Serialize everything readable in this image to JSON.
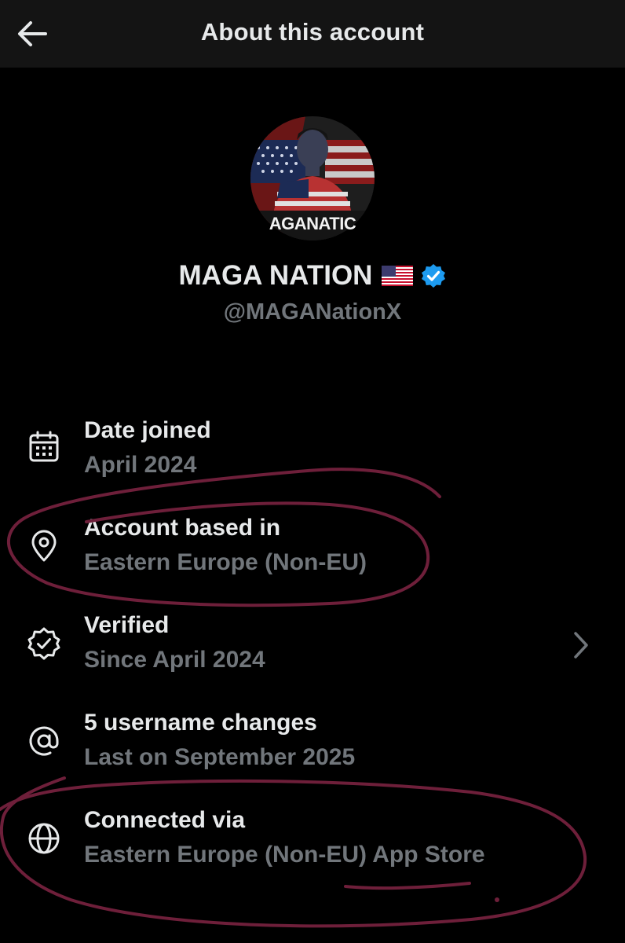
{
  "header": {
    "title": "About this account",
    "back_icon": "arrow-left-icon"
  },
  "profile": {
    "avatar_text": "AGANATIC",
    "display_name": "MAGA NATION",
    "flag_emoji": "🇺🇸",
    "verified": true,
    "handle": "@MAGANationX"
  },
  "info": [
    {
      "icon": "calendar-icon",
      "label": "Date joined",
      "value": "April 2024"
    },
    {
      "icon": "location-pin-icon",
      "label": "Account based in",
      "value": "Eastern Europe (Non-EU)"
    },
    {
      "icon": "verified-badge-icon",
      "label": "Verified",
      "value": "Since April 2024",
      "has_chevron": true
    },
    {
      "icon": "at-sign-icon",
      "label": "5 username changes",
      "value": "Last on September 2025"
    },
    {
      "icon": "globe-icon",
      "label": "Connected via",
      "value": "Eastern Europe (Non-EU) App Store"
    }
  ],
  "colors": {
    "background": "#000000",
    "header_background": "#141414",
    "primary_text": "#e7e9ea",
    "secondary_text": "#71767b",
    "verified_blue": "#1d9bf0",
    "annotation_ink": "#6e1f3a"
  }
}
